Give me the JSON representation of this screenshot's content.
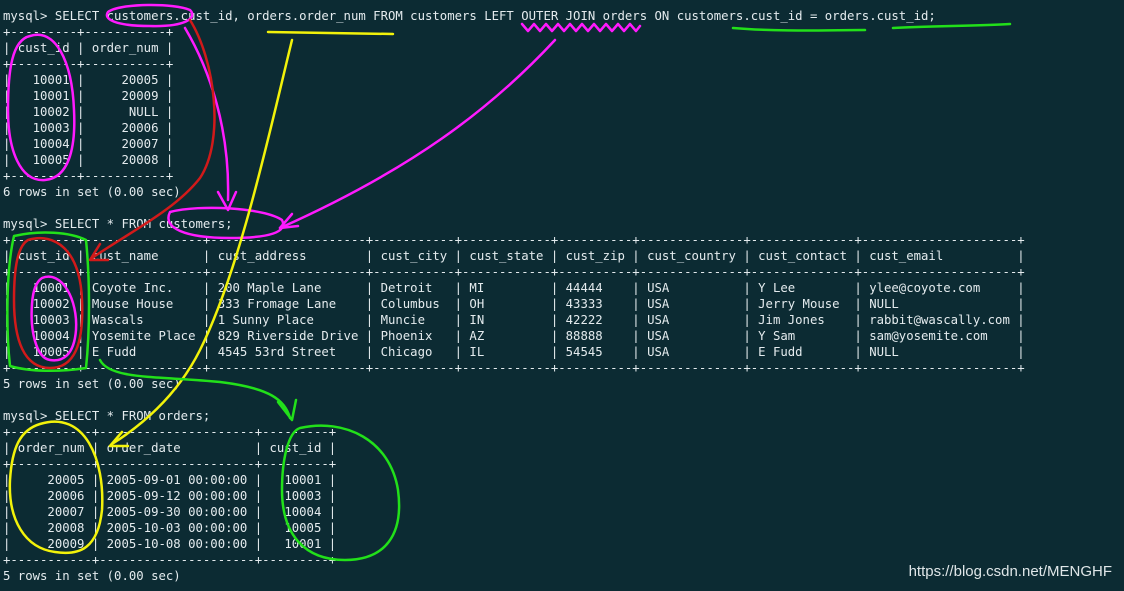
{
  "terminal": {
    "lines": [
      "mysql> SELECT customers.cust_id, orders.order_num FROM customers LEFT OUTER JOIN orders ON customers.cust_id = orders.cust_id;",
      "+---------+-----------+",
      "| cust_id | order_num |",
      "+---------+-----------+",
      "|   10001 |     20005 |",
      "|   10001 |     20009 |",
      "|   10002 |      NULL |",
      "|   10003 |     20006 |",
      "|   10004 |     20007 |",
      "|   10005 |     20008 |",
      "+---------+-----------+",
      "6 rows in set (0.00 sec)",
      "",
      "mysql> SELECT * FROM customers;",
      "+---------+----------------+---------------------+-----------+------------+----------+--------------+--------------+---------------------+",
      "| cust_id | cust_name      | cust_address        | cust_city | cust_state | cust_zip | cust_country | cust_contact | cust_email          |",
      "+---------+----------------+---------------------+-----------+------------+----------+--------------+--------------+---------------------+",
      "|   10001 | Coyote Inc.    | 200 Maple Lane      | Detroit   | MI         | 44444    | USA          | Y Lee        | ylee@coyote.com     |",
      "|   10002 | Mouse House    | 333 Fromage Lane    | Columbus  | OH         | 43333    | USA          | Jerry Mouse  | NULL                |",
      "|   10003 | Wascals        | 1 Sunny Place       | Muncie    | IN         | 42222    | USA          | Jim Jones    | rabbit@wascally.com |",
      "|   10004 | Yosemite Place | 829 Riverside Drive | Phoenix   | AZ         | 88888    | USA          | Y Sam        | sam@yosemite.com    |",
      "|   10005 | E Fudd         | 4545 53rd Street    | Chicago   | IL         | 54545    | USA          | E Fudd       | NULL                |",
      "+---------+----------------+---------------------+-----------+------------+----------+--------------+--------------+---------------------+",
      "5 rows in set (0.00 sec)",
      "",
      "mysql> SELECT * FROM orders;",
      "+-----------+---------------------+---------+",
      "| order_num | order_date          | cust_id |",
      "+-----------+---------------------+---------+",
      "|     20005 | 2005-09-01 00:00:00 |   10001 |",
      "|     20006 | 2005-09-12 00:00:00 |   10003 |",
      "|     20007 | 2005-09-30 00:00:00 |   10004 |",
      "|     20008 | 2005-10-03 00:00:00 |   10005 |",
      "|     20009 | 2005-10-08 00:00:00 |   10001 |",
      "+-----------+---------------------+---------+",
      "5 rows in set (0.00 sec)"
    ]
  },
  "watermark": "https://blog.csdn.net/MENGHF",
  "colors": {
    "background": "#0c2b33",
    "text": "#e4ebee",
    "annotation_magenta": "#ff1aff",
    "annotation_red": "#d11a1a",
    "annotation_yellow": "#f2f20a",
    "annotation_green": "#22e01a"
  }
}
